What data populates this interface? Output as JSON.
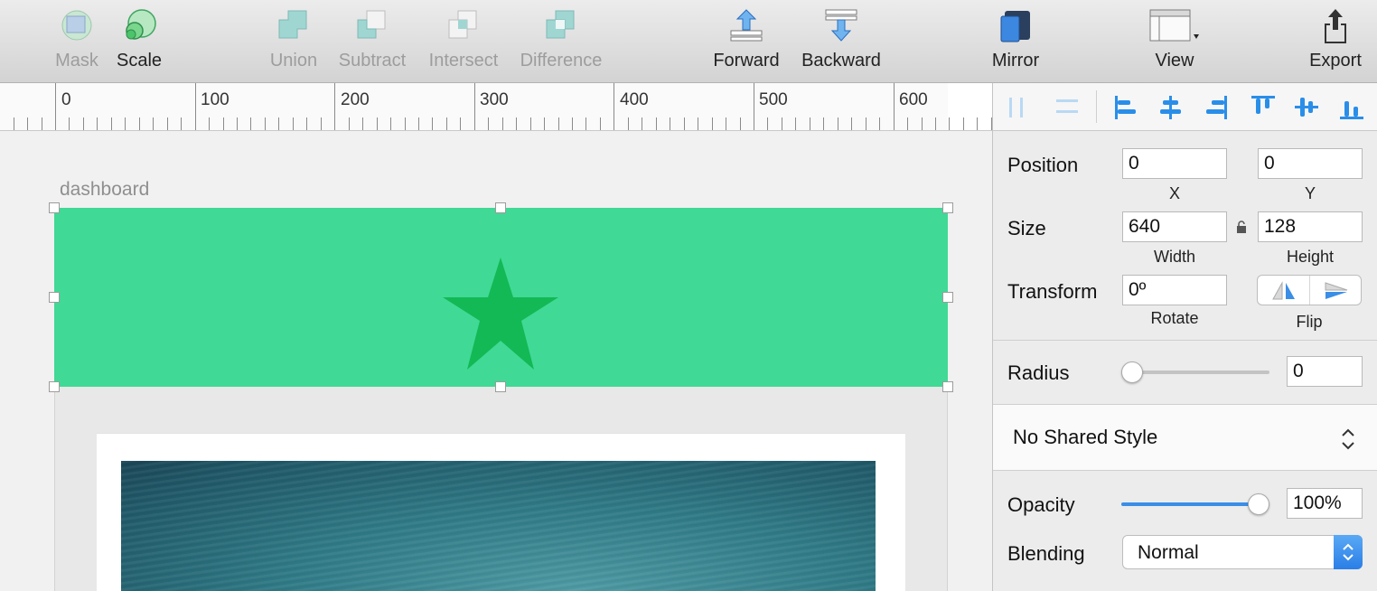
{
  "toolbar": {
    "mask": "Mask",
    "scale": "Scale",
    "union": "Union",
    "subtract": "Subtract",
    "intersect": "Intersect",
    "difference": "Difference",
    "forward": "Forward",
    "backward": "Backward",
    "mirror": "Mirror",
    "view": "View",
    "export": "Export"
  },
  "ruler": {
    "marks": [
      "0",
      "100",
      "200",
      "300",
      "400",
      "500",
      "600"
    ]
  },
  "canvas": {
    "artboard_name": "dashboard",
    "header_color": "#40d995",
    "star_color": "#12b955"
  },
  "inspector": {
    "position": {
      "label": "Position",
      "x": "0",
      "y": "0",
      "x_caption": "X",
      "y_caption": "Y"
    },
    "size": {
      "label": "Size",
      "width": "640",
      "height": "128",
      "width_caption": "Width",
      "height_caption": "Height"
    },
    "transform": {
      "label": "Transform",
      "rotate": "0º",
      "rotate_caption": "Rotate",
      "flip_caption": "Flip"
    },
    "radius": {
      "label": "Radius",
      "value": "0",
      "slider_fraction": 0
    },
    "shared_style": "No Shared Style",
    "opacity": {
      "label": "Opacity",
      "value": "100%",
      "slider_fraction": 1
    },
    "blending": {
      "label": "Blending",
      "value": "Normal"
    },
    "accent_color": "#3a8ee6"
  }
}
